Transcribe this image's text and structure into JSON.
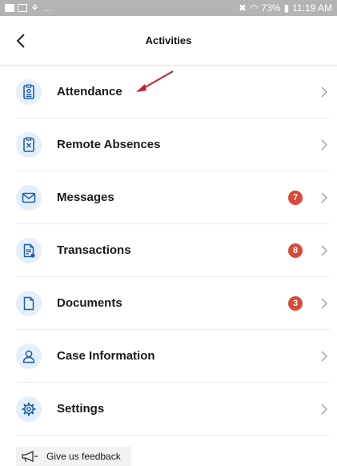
{
  "status_bar": {
    "battery": "73%",
    "time": "11:19 AM"
  },
  "header": {
    "title": "Activities"
  },
  "menu": {
    "items": [
      {
        "label": "Attendance",
        "icon": "attendance-icon",
        "badge": ""
      },
      {
        "label": "Remote Absences",
        "icon": "remote-absence-icon",
        "badge": ""
      },
      {
        "label": "Messages",
        "icon": "envelope-icon",
        "badge": "7"
      },
      {
        "label": "Transactions",
        "icon": "transaction-document-icon",
        "badge": "8"
      },
      {
        "label": "Documents",
        "icon": "document-icon",
        "badge": "3"
      },
      {
        "label": "Case Information",
        "icon": "person-icon",
        "badge": ""
      },
      {
        "label": "Settings",
        "icon": "gear-icon",
        "badge": ""
      }
    ]
  },
  "feedback": {
    "label": "Give us feedback",
    "icon": "megaphone-icon"
  },
  "colors": {
    "accent": "#1f5fa8",
    "icon_bg": "#e4eff9",
    "badge": "#d94a3a",
    "annotation_arrow": "#c0262d"
  }
}
